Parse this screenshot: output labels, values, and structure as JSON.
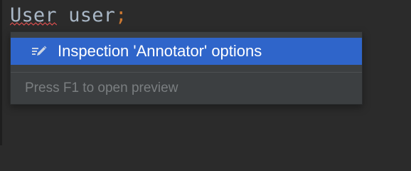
{
  "editor": {
    "code": {
      "type_token": "User",
      "space": " ",
      "var_token": "user",
      "semicolon": ";"
    }
  },
  "popup": {
    "item": {
      "icon": "edit-pencil-icon",
      "label": "Inspection 'Annotator' options"
    },
    "hint": "Press F1 to open preview"
  },
  "colors": {
    "background": "#2b2b2b",
    "code_text": "#a9b7c6",
    "semicolon": "#cc7832",
    "error_squiggle": "#d94f4f",
    "popup_bg": "#3c3f41",
    "selection": "#2f65ca",
    "hint_text": "#7a7e80"
  }
}
